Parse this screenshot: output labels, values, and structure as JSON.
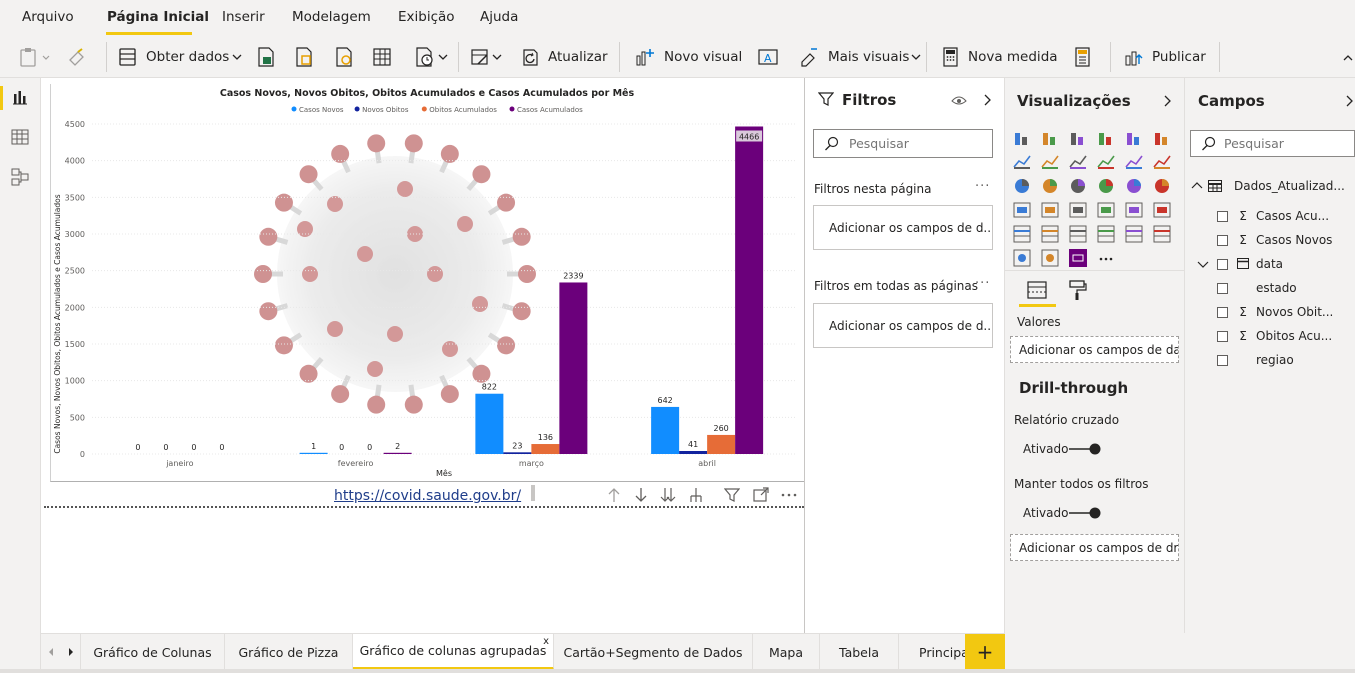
{
  "menu": {
    "tabs": [
      "Arquivo",
      "Página Inicial",
      "Inserir",
      "Modelagem",
      "Exibição",
      "Ajuda"
    ],
    "active": "Página Inicial"
  },
  "ribbon": {
    "get_data": "Obter dados",
    "refresh": "Atualizar",
    "new_visual": "Novo visual",
    "more_visuals": "Mais visuais",
    "new_measure": "Nova medida",
    "publish": "Publicar"
  },
  "chart_data": {
    "type": "bar",
    "title": "Casos Novos, Novos Obitos, Obitos Acumulados e Casos Acumulados por Mês",
    "xlabel": "Mês",
    "ylabel": "Casos Novos, Novos Obitos, Obitos Acumulados e Casos Acumulados",
    "categories": [
      "janeiro",
      "fevereiro",
      "março",
      "abril"
    ],
    "series": [
      {
        "name": "Casos Novos",
        "color": "#118dff",
        "values": [
          0,
          1,
          822,
          642
        ]
      },
      {
        "name": "Novos Obitos",
        "color": "#12239e",
        "values": [
          0,
          0,
          23,
          41
        ]
      },
      {
        "name": "Obitos Acumulados",
        "color": "#e66c37",
        "values": [
          0,
          0,
          136,
          260
        ]
      },
      {
        "name": "Casos Acumulados",
        "color": "#6b007b",
        "values": [
          0,
          2,
          2339,
          4466
        ]
      }
    ],
    "yticks": [
      0,
      500,
      1000,
      1500,
      2000,
      2500,
      3000,
      3500,
      4000,
      4500
    ],
    "ylim": [
      0,
      4500
    ],
    "legend": "top-center",
    "grid": true,
    "background": "coronavirus-image"
  },
  "canvas": {
    "source_link": "https://covid.saude.gov.br/"
  },
  "filters": {
    "title": "Filtros",
    "search_placeholder": "Pesquisar",
    "on_this_page": "Filtros nesta página",
    "on_all_pages": "Filtros em todas as páginas",
    "add_fields": "Adicionar os campos de d..."
  },
  "visualizations": {
    "title": "Visualizações",
    "values_label": "Valores",
    "values_zone": "Adicionar os campos de da...",
    "drillthrough_title": "Drill-through",
    "cross_report": "Relatório cruzado",
    "cross_report_state": "Ativado",
    "keep_filters": "Manter todos os filtros",
    "keep_filters_state": "Ativado",
    "drill_zone": "Adicionar os campos de dr..."
  },
  "fields": {
    "title": "Campos",
    "search_placeholder": "Pesquisar",
    "table_name": "Dados_Atualizad...",
    "items": [
      {
        "label": "Casos Acu...",
        "sigma": "Σ"
      },
      {
        "label": "Casos Novos",
        "sigma": "Σ"
      },
      {
        "label": "data",
        "sigma": ""
      },
      {
        "label": "estado",
        "sigma": ""
      },
      {
        "label": "Novos Obit...",
        "sigma": "Σ"
      },
      {
        "label": "Obitos Acu...",
        "sigma": "Σ"
      },
      {
        "label": "regiao",
        "sigma": ""
      }
    ]
  },
  "pages": {
    "tabs": [
      "Gráfico de Colunas",
      "Gráfico de Pizza",
      "Gráfico de colunas agrupadas",
      "Cartão+Segmento de Dados",
      "Mapa",
      "Tabela",
      "Principal"
    ],
    "active": "Gráfico de colunas agrupadas",
    "close": "x",
    "add": "+"
  }
}
